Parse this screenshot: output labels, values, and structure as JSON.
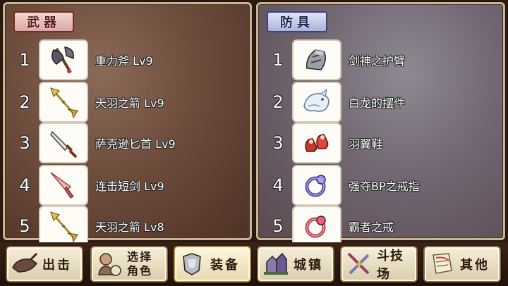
{
  "weapons": {
    "tab_label": "武器",
    "items": [
      {
        "rank": "1",
        "name": "重力斧 Lv9",
        "icon": "axe-icon"
      },
      {
        "rank": "2",
        "name": "天羽之箭 Lv9",
        "icon": "arrow-icon"
      },
      {
        "rank": "3",
        "name": "萨克逊匕首 Lv9",
        "icon": "dagger-icon"
      },
      {
        "rank": "4",
        "name": "连击短剑 Lv9",
        "icon": "short-sword-icon"
      },
      {
        "rank": "5",
        "name": "天羽之箭 Lv8",
        "icon": "arrow-icon"
      }
    ]
  },
  "armor": {
    "tab_label": "防具",
    "items": [
      {
        "rank": "1",
        "name": "剑神之护臂",
        "icon": "gauntlet-icon"
      },
      {
        "rank": "2",
        "name": "白龙的摆件",
        "icon": "white-dragon-icon"
      },
      {
        "rank": "3",
        "name": "羽翼鞋",
        "icon": "shoes-icon"
      },
      {
        "rank": "4",
        "name": "强夺BP之戒指",
        "icon": "ring-icon"
      },
      {
        "rank": "5",
        "name": "霸者之戒",
        "icon": "ring-icon"
      }
    ]
  },
  "nav": {
    "sortie": "出击",
    "select_char_line1": "选择",
    "select_char_line2": "角色",
    "equipment": "装备",
    "town": "城镇",
    "arena": "斗技场",
    "other": "其他"
  },
  "colors": {
    "weapon_tab": "#7b2a2a",
    "armor_tab": "#3a4478",
    "panel_border": "#c8b596"
  }
}
